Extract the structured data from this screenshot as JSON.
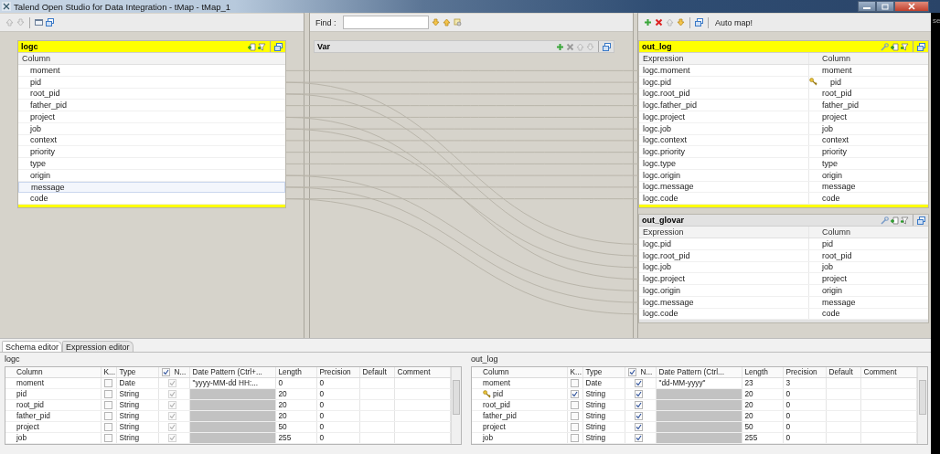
{
  "window": {
    "title": "Talend Open Studio for Data Integration - tMap - tMap_1"
  },
  "desktop_text": "se",
  "find": {
    "label": "Find :"
  },
  "inputs": [
    {
      "name": "logc",
      "selected": true,
      "column_header": "Column",
      "rows": [
        {
          "name": "moment",
          "selected": false
        },
        {
          "name": "pid",
          "selected": false
        },
        {
          "name": "root_pid",
          "selected": false
        },
        {
          "name": "father_pid",
          "selected": false
        },
        {
          "name": "project",
          "selected": false
        },
        {
          "name": "job",
          "selected": false
        },
        {
          "name": "context",
          "selected": false
        },
        {
          "name": "priority",
          "selected": false
        },
        {
          "name": "type",
          "selected": false
        },
        {
          "name": "origin",
          "selected": false
        },
        {
          "name": "message",
          "selected": true
        },
        {
          "name": "code",
          "selected": false
        }
      ]
    }
  ],
  "var_table": {
    "name": "Var"
  },
  "output_toolbar": {
    "auto_map": "Auto map!"
  },
  "outputs": [
    {
      "name": "out_log",
      "selected": true,
      "headers": [
        "Expression",
        "Column"
      ],
      "rows": [
        {
          "expression": "logc.moment",
          "column": "moment",
          "key": false
        },
        {
          "expression": "logc.pid",
          "column": "pid",
          "key": true
        },
        {
          "expression": "logc.root_pid",
          "column": "root_pid",
          "key": false
        },
        {
          "expression": "logc.father_pid",
          "column": "father_pid",
          "key": false
        },
        {
          "expression": "logc.project",
          "column": "project",
          "key": false
        },
        {
          "expression": "logc.job",
          "column": "job",
          "key": false
        },
        {
          "expression": "logc.context",
          "column": "context",
          "key": false
        },
        {
          "expression": "logc.priority",
          "column": "priority",
          "key": false
        },
        {
          "expression": "logc.type",
          "column": "type",
          "key": false
        },
        {
          "expression": "logc.origin",
          "column": "origin",
          "key": false
        },
        {
          "expression": "logc.message",
          "column": "message",
          "key": false
        },
        {
          "expression": "logc.code",
          "column": "code",
          "key": false
        }
      ]
    },
    {
      "name": "out_glovar",
      "selected": false,
      "headers": [
        "Expression",
        "Column"
      ],
      "rows": [
        {
          "expression": "logc.pid",
          "column": "pid",
          "key": false
        },
        {
          "expression": "logc.root_pid",
          "column": "root_pid",
          "key": false
        },
        {
          "expression": "logc.job",
          "column": "job",
          "key": false
        },
        {
          "expression": "logc.project",
          "column": "project",
          "key": false
        },
        {
          "expression": "logc.origin",
          "column": "origin",
          "key": false
        },
        {
          "expression": "logc.message",
          "column": "message",
          "key": false
        },
        {
          "expression": "logc.code",
          "column": "code",
          "key": false
        }
      ]
    }
  ],
  "bottom_tabs": [
    {
      "label": "Schema editor",
      "selected": true
    },
    {
      "label": "Expression editor",
      "selected": false
    }
  ],
  "schema_editors": [
    {
      "title": "logc",
      "editable": false,
      "nullable_header_checked": true,
      "headers": [
        "Column",
        "K...",
        "Type",
        "N...",
        "Date Pattern (Ctrl+...",
        "Length",
        "Precision",
        "Default",
        "Comment"
      ],
      "rows": [
        {
          "column": "moment",
          "key": false,
          "type": "Date",
          "nullable": true,
          "date_pattern": "\"yyyy-MM-dd HH:...",
          "length": "0",
          "precision": "0"
        },
        {
          "column": "pid",
          "key": false,
          "type": "String",
          "nullable": true,
          "length": "20",
          "precision": "0"
        },
        {
          "column": "root_pid",
          "key": false,
          "type": "String",
          "nullable": true,
          "length": "20",
          "precision": "0"
        },
        {
          "column": "father_pid",
          "key": false,
          "type": "String",
          "nullable": true,
          "length": "20",
          "precision": "0"
        },
        {
          "column": "project",
          "key": false,
          "type": "String",
          "nullable": true,
          "length": "50",
          "precision": "0"
        },
        {
          "column": "job",
          "key": false,
          "type": "String",
          "nullable": true,
          "length": "255",
          "precision": "0"
        }
      ]
    },
    {
      "title": "out_log",
      "editable": true,
      "nullable_header_checked": true,
      "headers": [
        "Column",
        "K...",
        "Type",
        "N...",
        "Date Pattern (Ctrl...",
        "Length",
        "Precision",
        "Default",
        "Comment"
      ],
      "rows": [
        {
          "column": "moment",
          "key": false,
          "type": "Date",
          "nullable": true,
          "date_pattern": "\"dd-MM-yyyy\"",
          "length": "23",
          "precision": "3"
        },
        {
          "column": "pid",
          "key": true,
          "type": "String",
          "nullable": true,
          "length": "20",
          "precision": "0"
        },
        {
          "column": "root_pid",
          "key": false,
          "type": "String",
          "nullable": true,
          "length": "20",
          "precision": "0"
        },
        {
          "column": "father_pid",
          "key": false,
          "type": "String",
          "nullable": true,
          "length": "20",
          "precision": "0"
        },
        {
          "column": "project",
          "key": false,
          "type": "String",
          "nullable": true,
          "length": "50",
          "precision": "0"
        },
        {
          "column": "job",
          "key": false,
          "type": "String",
          "nullable": true,
          "length": "255",
          "precision": "0"
        }
      ]
    }
  ]
}
